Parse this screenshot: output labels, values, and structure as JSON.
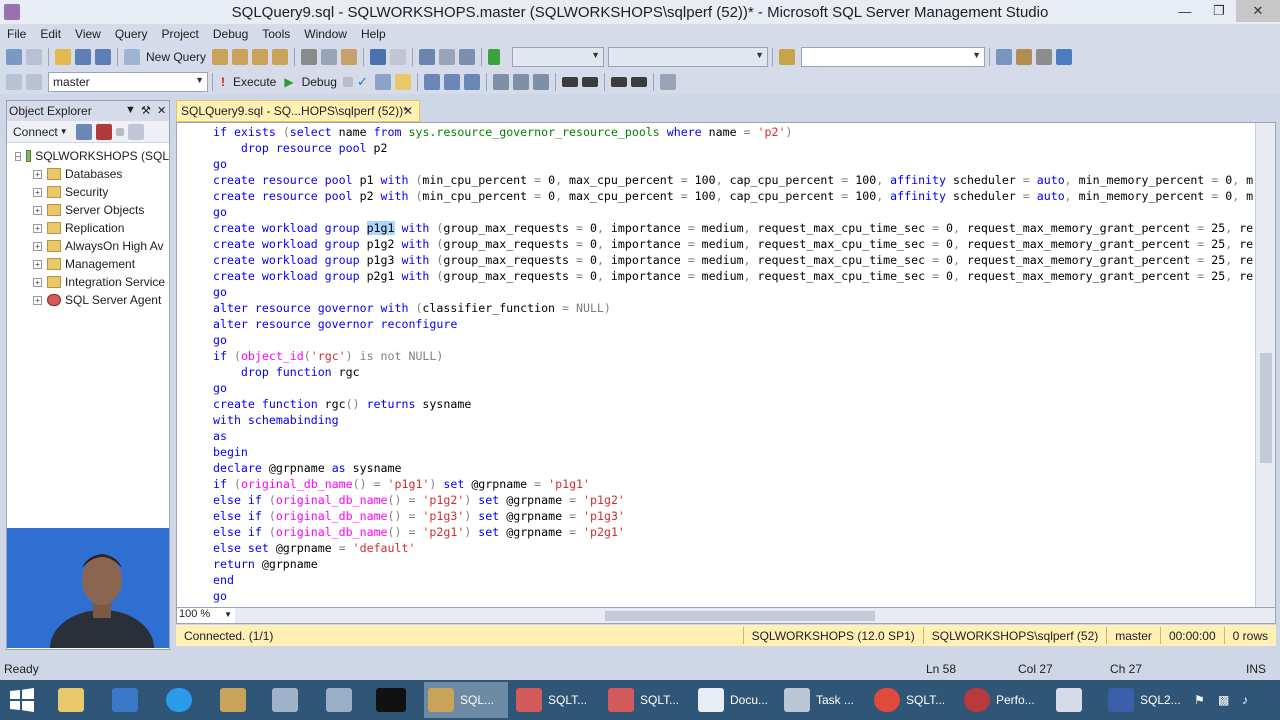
{
  "window": {
    "title": "SQLQuery9.sql - SQLWORKSHOPS.master (SQLWORKSHOPS\\sqlperf (52))* - Microsoft SQL Server Management Studio"
  },
  "menu": [
    "File",
    "Edit",
    "View",
    "Query",
    "Project",
    "Debug",
    "Tools",
    "Window",
    "Help"
  ],
  "toolbar": {
    "new_query": "New Query",
    "database": "master",
    "execute": "Execute",
    "debug": "Debug"
  },
  "object_explorer": {
    "title": "Object Explorer",
    "connect": "Connect",
    "root": "SQLWORKSHOPS (SQL",
    "items": [
      "Databases",
      "Security",
      "Server Objects",
      "Replication",
      "AlwaysOn High Av",
      "Management",
      "Integration Service",
      "SQL Server Agent"
    ]
  },
  "editor": {
    "tab_label": "SQLQuery9.sql - SQ...HOPS\\sqlperf (52))*",
    "zoom": "100 %"
  },
  "query_status": {
    "connected": "Connected. (1/1)",
    "server": "SQLWORKSHOPS (12.0 SP1)",
    "login": "SQLWORKSHOPS\\sqlperf (52)",
    "database": "master",
    "time": "00:00:00",
    "rows": "0 rows"
  },
  "status": {
    "ready": "Ready",
    "ln": "Ln 58",
    "col": "Col 27",
    "ch": "Ch 27",
    "mode": "INS"
  },
  "taskbar": [
    "SQL...",
    "SQLT...",
    "SQLT...",
    "Docu...",
    "Task ...",
    "SQLT...",
    "Perfo...",
    "SQL2..."
  ],
  "colors": {
    "keyword": "#0000ff",
    "function": "#ff00ff",
    "string": "#d12d2d",
    "operator": "#808080",
    "selection": "#add6ff",
    "tab_active": "#fff1b5"
  }
}
